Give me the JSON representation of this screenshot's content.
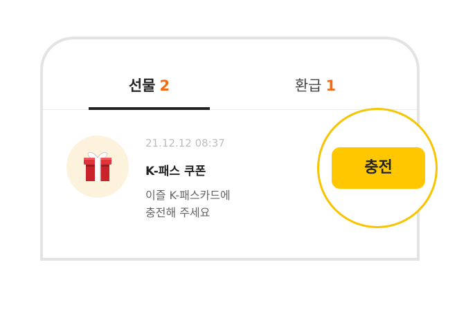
{
  "tabs": [
    {
      "label": "선물",
      "count": "2",
      "active": true
    },
    {
      "label": "환급",
      "count": "1",
      "active": false
    }
  ],
  "item": {
    "icon": "gift-icon",
    "date": "21.12.12 08:37",
    "title": "K-패스 쿠폰",
    "description_line1": "이즐 K-패스카드에",
    "description_line2": "충전해 주세요"
  },
  "action": {
    "charge_label": "충전"
  },
  "colors": {
    "accent": "#fec700",
    "count": "#f26a13",
    "ring": "#f7c400",
    "gift_red": "#d8262c",
    "gift_bg": "#fdf3dc"
  }
}
